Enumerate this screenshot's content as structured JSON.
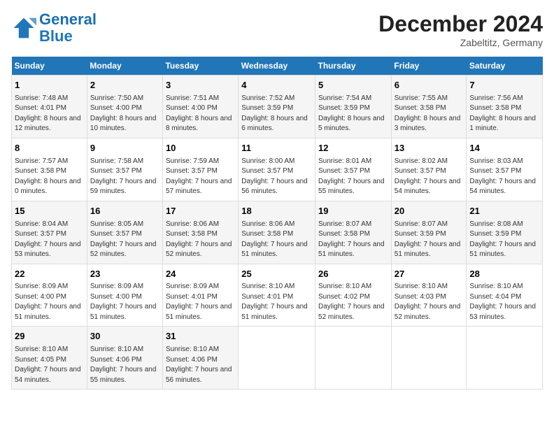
{
  "logo": {
    "line1": "General",
    "line2": "Blue"
  },
  "title": "December 2024",
  "subtitle": "Zabeltitz, Germany",
  "days_of_week": [
    "Sunday",
    "Monday",
    "Tuesday",
    "Wednesday",
    "Thursday",
    "Friday",
    "Saturday"
  ],
  "weeks": [
    [
      {
        "day": "1",
        "sunrise": "Sunrise: 7:48 AM",
        "sunset": "Sunset: 4:01 PM",
        "daylight": "Daylight: 8 hours and 12 minutes."
      },
      {
        "day": "2",
        "sunrise": "Sunrise: 7:50 AM",
        "sunset": "Sunset: 4:00 PM",
        "daylight": "Daylight: 8 hours and 10 minutes."
      },
      {
        "day": "3",
        "sunrise": "Sunrise: 7:51 AM",
        "sunset": "Sunset: 4:00 PM",
        "daylight": "Daylight: 8 hours and 8 minutes."
      },
      {
        "day": "4",
        "sunrise": "Sunrise: 7:52 AM",
        "sunset": "Sunset: 3:59 PM",
        "daylight": "Daylight: 8 hours and 6 minutes."
      },
      {
        "day": "5",
        "sunrise": "Sunrise: 7:54 AM",
        "sunset": "Sunset: 3:59 PM",
        "daylight": "Daylight: 8 hours and 5 minutes."
      },
      {
        "day": "6",
        "sunrise": "Sunrise: 7:55 AM",
        "sunset": "Sunset: 3:58 PM",
        "daylight": "Daylight: 8 hours and 3 minutes."
      },
      {
        "day": "7",
        "sunrise": "Sunrise: 7:56 AM",
        "sunset": "Sunset: 3:58 PM",
        "daylight": "Daylight: 8 hours and 1 minute."
      }
    ],
    [
      {
        "day": "8",
        "sunrise": "Sunrise: 7:57 AM",
        "sunset": "Sunset: 3:58 PM",
        "daylight": "Daylight: 8 hours and 0 minutes."
      },
      {
        "day": "9",
        "sunrise": "Sunrise: 7:58 AM",
        "sunset": "Sunset: 3:57 PM",
        "daylight": "Daylight: 7 hours and 59 minutes."
      },
      {
        "day": "10",
        "sunrise": "Sunrise: 7:59 AM",
        "sunset": "Sunset: 3:57 PM",
        "daylight": "Daylight: 7 hours and 57 minutes."
      },
      {
        "day": "11",
        "sunrise": "Sunrise: 8:00 AM",
        "sunset": "Sunset: 3:57 PM",
        "daylight": "Daylight: 7 hours and 56 minutes."
      },
      {
        "day": "12",
        "sunrise": "Sunrise: 8:01 AM",
        "sunset": "Sunset: 3:57 PM",
        "daylight": "Daylight: 7 hours and 55 minutes."
      },
      {
        "day": "13",
        "sunrise": "Sunrise: 8:02 AM",
        "sunset": "Sunset: 3:57 PM",
        "daylight": "Daylight: 7 hours and 54 minutes."
      },
      {
        "day": "14",
        "sunrise": "Sunrise: 8:03 AM",
        "sunset": "Sunset: 3:57 PM",
        "daylight": "Daylight: 7 hours and 54 minutes."
      }
    ],
    [
      {
        "day": "15",
        "sunrise": "Sunrise: 8:04 AM",
        "sunset": "Sunset: 3:57 PM",
        "daylight": "Daylight: 7 hours and 53 minutes."
      },
      {
        "day": "16",
        "sunrise": "Sunrise: 8:05 AM",
        "sunset": "Sunset: 3:57 PM",
        "daylight": "Daylight: 7 hours and 52 minutes."
      },
      {
        "day": "17",
        "sunrise": "Sunrise: 8:06 AM",
        "sunset": "Sunset: 3:58 PM",
        "daylight": "Daylight: 7 hours and 52 minutes."
      },
      {
        "day": "18",
        "sunrise": "Sunrise: 8:06 AM",
        "sunset": "Sunset: 3:58 PM",
        "daylight": "Daylight: 7 hours and 51 minutes."
      },
      {
        "day": "19",
        "sunrise": "Sunrise: 8:07 AM",
        "sunset": "Sunset: 3:58 PM",
        "daylight": "Daylight: 7 hours and 51 minutes."
      },
      {
        "day": "20",
        "sunrise": "Sunrise: 8:07 AM",
        "sunset": "Sunset: 3:59 PM",
        "daylight": "Daylight: 7 hours and 51 minutes."
      },
      {
        "day": "21",
        "sunrise": "Sunrise: 8:08 AM",
        "sunset": "Sunset: 3:59 PM",
        "daylight": "Daylight: 7 hours and 51 minutes."
      }
    ],
    [
      {
        "day": "22",
        "sunrise": "Sunrise: 8:09 AM",
        "sunset": "Sunset: 4:00 PM",
        "daylight": "Daylight: 7 hours and 51 minutes."
      },
      {
        "day": "23",
        "sunrise": "Sunrise: 8:09 AM",
        "sunset": "Sunset: 4:00 PM",
        "daylight": "Daylight: 7 hours and 51 minutes."
      },
      {
        "day": "24",
        "sunrise": "Sunrise: 8:09 AM",
        "sunset": "Sunset: 4:01 PM",
        "daylight": "Daylight: 7 hours and 51 minutes."
      },
      {
        "day": "25",
        "sunrise": "Sunrise: 8:10 AM",
        "sunset": "Sunset: 4:01 PM",
        "daylight": "Daylight: 7 hours and 51 minutes."
      },
      {
        "day": "26",
        "sunrise": "Sunrise: 8:10 AM",
        "sunset": "Sunset: 4:02 PM",
        "daylight": "Daylight: 7 hours and 52 minutes."
      },
      {
        "day": "27",
        "sunrise": "Sunrise: 8:10 AM",
        "sunset": "Sunset: 4:03 PM",
        "daylight": "Daylight: 7 hours and 52 minutes."
      },
      {
        "day": "28",
        "sunrise": "Sunrise: 8:10 AM",
        "sunset": "Sunset: 4:04 PM",
        "daylight": "Daylight: 7 hours and 53 minutes."
      }
    ],
    [
      {
        "day": "29",
        "sunrise": "Sunrise: 8:10 AM",
        "sunset": "Sunset: 4:05 PM",
        "daylight": "Daylight: 7 hours and 54 minutes."
      },
      {
        "day": "30",
        "sunrise": "Sunrise: 8:10 AM",
        "sunset": "Sunset: 4:06 PM",
        "daylight": "Daylight: 7 hours and 55 minutes."
      },
      {
        "day": "31",
        "sunrise": "Sunrise: 8:10 AM",
        "sunset": "Sunset: 4:06 PM",
        "daylight": "Daylight: 7 hours and 56 minutes."
      },
      null,
      null,
      null,
      null
    ]
  ]
}
